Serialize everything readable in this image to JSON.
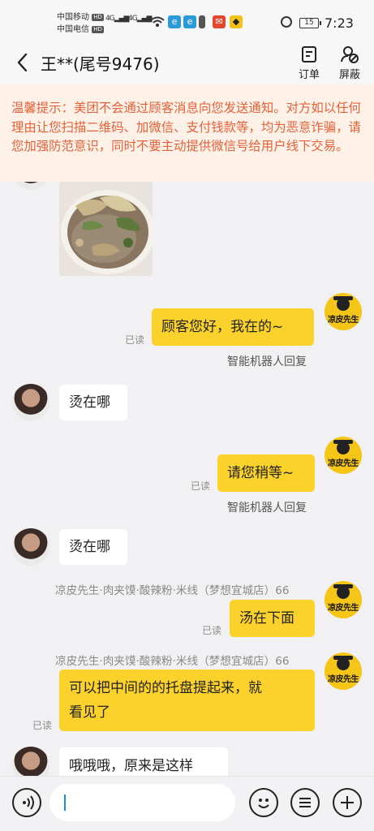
{
  "status_bar": {
    "carrier1": "中国移动",
    "carrier2": "中国电信",
    "hd": "HD",
    "net1": "4G",
    "net2": "4G",
    "battery": "15",
    "time": "7:23"
  },
  "header": {
    "title": "王**(尾号9476)",
    "order_label": "订单",
    "block_label": "屏蔽"
  },
  "notice": {
    "text": "温馨提示：美团不会通过顾客消息向您发送通知。对方如以任何理由让您扫描二维码、加微信、支付钱款等，均为恶意诈骗，请您加强防范意识，同时不要主动提供微信号给用户线下交易。"
  },
  "merchant_avatar": {
    "brand": "凉皮先生"
  },
  "messages": {
    "m1": {
      "text": "顾客您好，我在的~",
      "read": "已读",
      "note": "智能机器人回复"
    },
    "m2": {
      "text": "烫在哪"
    },
    "m3": {
      "text": "请您稍等~",
      "read": "已读",
      "note": "智能机器人回复"
    },
    "m4": {
      "text": "烫在哪"
    },
    "m5": {
      "sender": "凉皮先生·肉夹馍·酸辣粉·米线（梦想宜城店）66",
      "text": "汤在下面",
      "read": "已读"
    },
    "m6": {
      "sender": "凉皮先生·肉夹馍·酸辣粉·米线（梦想宜城店）66",
      "line1": "可以把中间的的托盘提起来，就",
      "line2": "看见了",
      "read": "已读"
    },
    "m7": {
      "text": "哦哦哦，原来是这样"
    }
  },
  "input": {
    "value": ""
  },
  "colors": {
    "bubble_yellow": "#fbd22c",
    "notice_text": "#e4613a",
    "notice_bg": "#fdf1e8",
    "cursor": "#1e88e5"
  }
}
